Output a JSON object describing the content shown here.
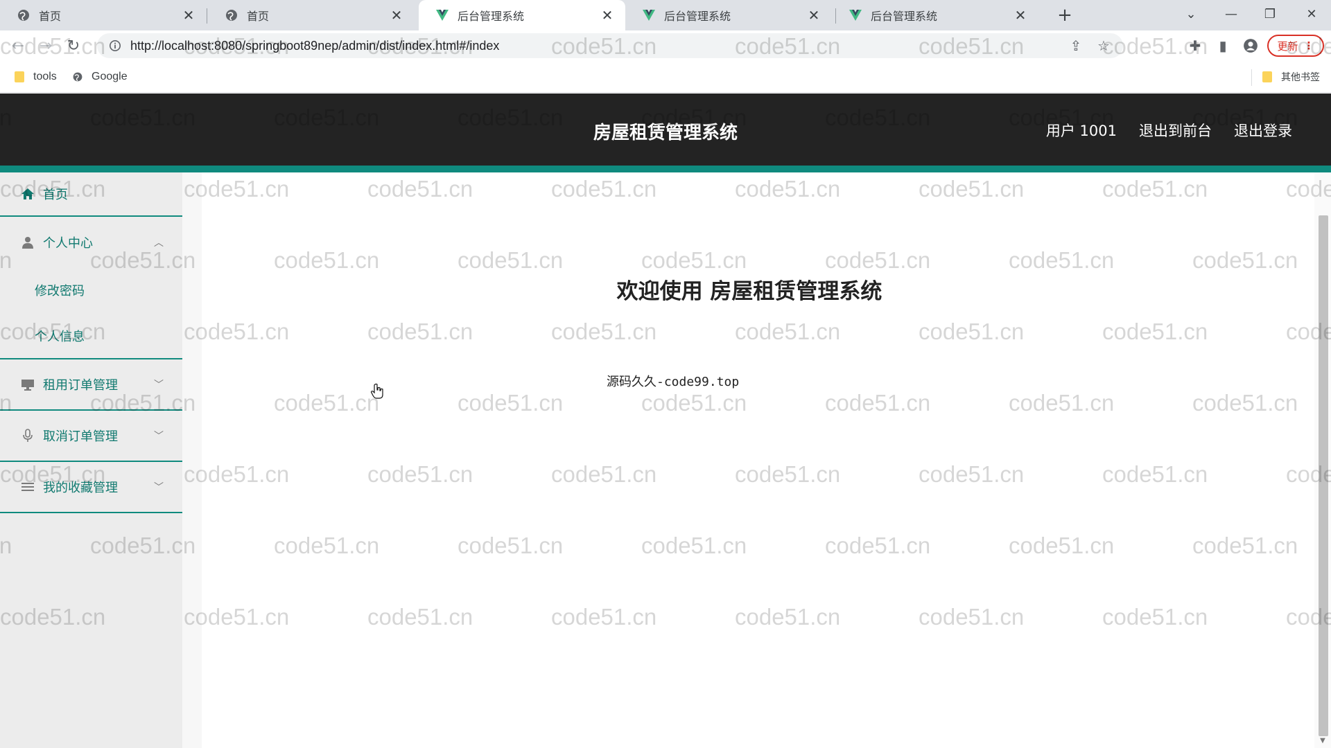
{
  "browser": {
    "tabs": [
      {
        "title": "首页",
        "icon": "globe-icon",
        "active": false
      },
      {
        "title": "首页",
        "icon": "globe-icon",
        "active": false
      },
      {
        "title": "后台管理系统",
        "icon": "vue-logo-icon",
        "active": true
      },
      {
        "title": "后台管理系统",
        "icon": "vue-logo-icon",
        "active": false
      },
      {
        "title": "后台管理系统",
        "icon": "vue-logo-icon",
        "active": false
      }
    ],
    "url": "http://localhost:8080/springboot89nep/admin/dist/index.html#/index",
    "update_label": "更新",
    "bookmarks": [
      {
        "label": "tools",
        "icon": "folder-icon"
      },
      {
        "label": "Google",
        "icon": "globe-icon"
      }
    ],
    "other_bookmarks": "其他书签"
  },
  "header": {
    "title": "房屋租赁管理系统",
    "user": "用户 1001",
    "back_to_front": "退出到前台",
    "logout": "退出登录"
  },
  "sidebar": {
    "home": "首页",
    "personal_center": {
      "label": "个人中心",
      "children": [
        "修改密码",
        "个人信息"
      ]
    },
    "rental_orders": "租用订单管理",
    "cancel_orders": "取消订单管理",
    "favorites": "我的收藏管理"
  },
  "main": {
    "welcome": "欢迎使用 房屋租赁管理系统",
    "source": "源码久久-code99.top"
  },
  "watermark": "code51.cn",
  "colors": {
    "accent": "#0f8a7e",
    "menu_text": "#10796f",
    "header_bg": "#232323",
    "sidebar_bg": "#ececec"
  }
}
